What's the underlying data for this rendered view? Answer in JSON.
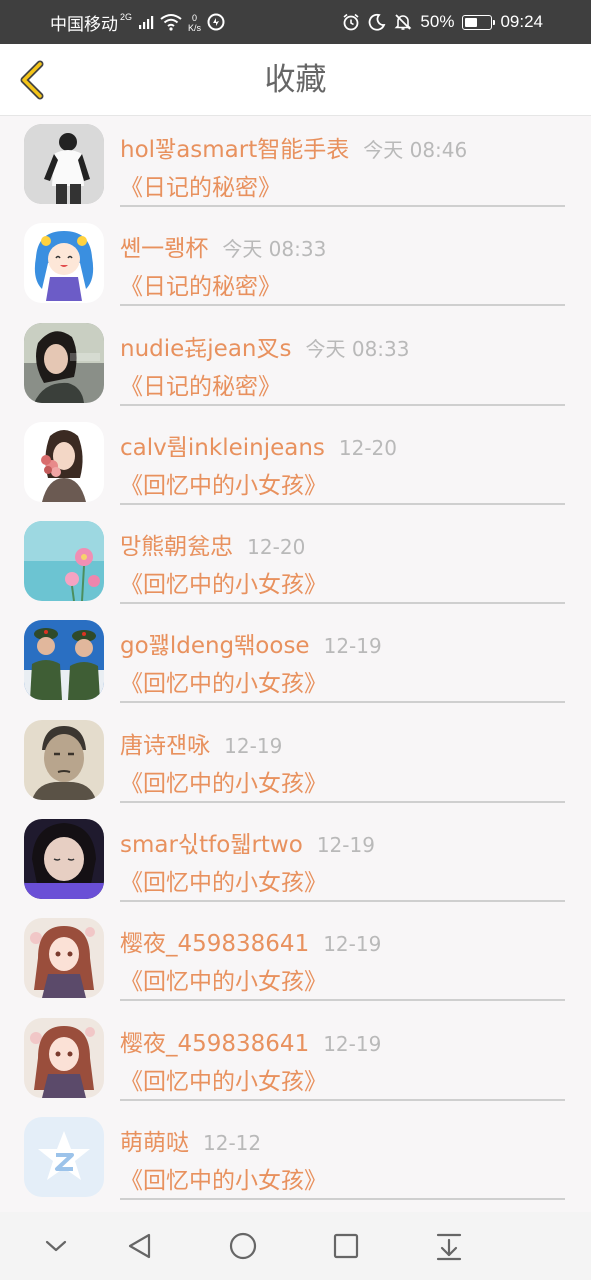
{
  "status_bar": {
    "carrier": "中国移动",
    "network": "2G",
    "speed_value": "0",
    "speed_unit": "K/s",
    "battery_percent": "50%",
    "battery_level": 0.5,
    "time": "09:24"
  },
  "header": {
    "title": "收藏",
    "back_icon": "chevron-left-icon",
    "accent": "#f5c518"
  },
  "favorites": [
    {
      "user": "hol꽣asmart智能手表",
      "time": "今天 08:46",
      "story": "《日记的秘密》",
      "avatar": "bw-person"
    },
    {
      "user": "쏀一뢩杯",
      "time": "今天 08:33",
      "story": "《日记的秘密》",
      "avatar": "anime-blue"
    },
    {
      "user": "nudie㐂jean㕚s",
      "time": "今天 08:33",
      "story": "《日记的秘密》",
      "avatar": "girl-photo"
    },
    {
      "user": "calv뤔inkleinjeans",
      "time": "12-20",
      "story": "《回忆中的小女孩》",
      "avatar": "flowers-girl"
    },
    {
      "user": "망熊朝瓫忠",
      "time": "12-20",
      "story": "《回忆中的小女孩》",
      "avatar": "pink-flowers"
    },
    {
      "user": "go꽳ldeng뙊oose",
      "time": "12-19",
      "story": "《回忆中的小女孩》",
      "avatar": "soldiers"
    },
    {
      "user": "唐诗쟨咏",
      "time": "12-19",
      "story": "《回忆中的小女孩》",
      "avatar": "old-man"
    },
    {
      "user": "smar싟tfo뒓rtwo",
      "time": "12-19",
      "story": "《回忆中的小女孩》",
      "avatar": "child-purple"
    },
    {
      "user": "樱夜_459838641",
      "time": "12-19",
      "story": "《回忆中的小女孩》",
      "avatar": "anime-girl"
    },
    {
      "user": "樱夜_459838641",
      "time": "12-19",
      "story": "《回忆中的小女孩》",
      "avatar": "anime-girl"
    },
    {
      "user": "萌萌哒",
      "time": "12-12",
      "story": "《回忆中的小女孩》",
      "avatar": "qzone-default"
    }
  ],
  "colors": {
    "accent_text": "#e8915e",
    "time_text": "#b9b9b9",
    "status_bar_bg": "#3f3f3f"
  },
  "nav_bar": {
    "icons": [
      "chevron-down-icon",
      "back-triangle-icon",
      "home-circle-icon",
      "recents-square-icon",
      "download-icon"
    ]
  }
}
